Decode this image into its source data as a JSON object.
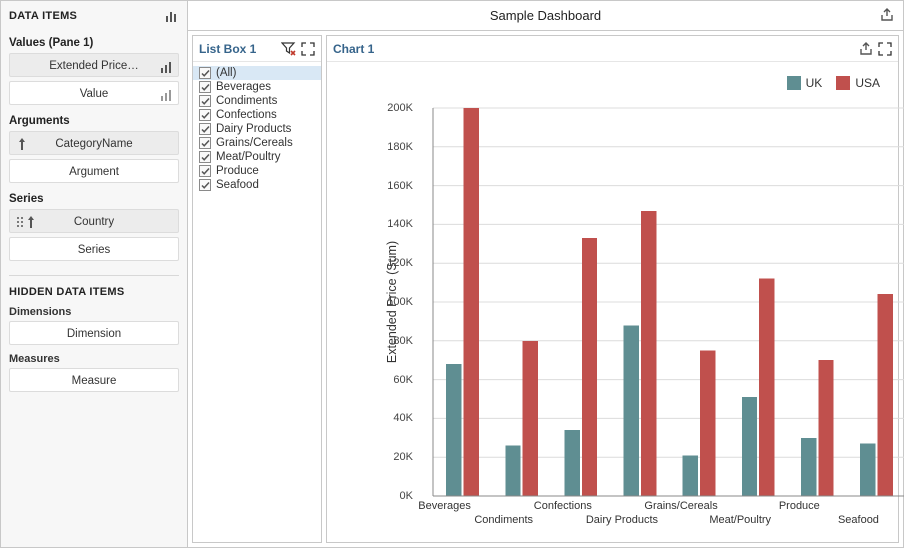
{
  "side": {
    "heading": "DATA ITEMS",
    "values_label": "Values (Pane 1)",
    "values_slot_filled": "Extended Price…",
    "values_slot_empty": "Value",
    "arguments_label": "Arguments",
    "arguments_slot_filled": "CategoryName",
    "arguments_slot_empty": "Argument",
    "series_label": "Series",
    "series_slot_filled": "Country",
    "series_slot_empty": "Series",
    "hidden_heading": "HIDDEN DATA ITEMS",
    "dimensions_label": "Dimensions",
    "dimensions_slot": "Dimension",
    "measures_label": "Measures",
    "measures_slot": "Measure"
  },
  "dashboard_title": "Sample Dashboard",
  "listbox": {
    "title": "List Box 1",
    "items": [
      "(All)",
      "Beverages",
      "Condiments",
      "Confections",
      "Dairy Products",
      "Grains/Cereals",
      "Meat/Poultry",
      "Produce",
      "Seafood"
    ],
    "selected_index": 0
  },
  "chart": {
    "title": "Chart 1",
    "legend": {
      "uk": "UK",
      "usa": "USA"
    },
    "colors": {
      "uk": "#5f8e92",
      "usa": "#c0504d"
    },
    "ylabel": "Extended Price (Sum)"
  },
  "chart_data": {
    "type": "bar",
    "title": "",
    "xlabel": "",
    "ylabel": "Extended Price (Sum)",
    "ylim": [
      0,
      200000
    ],
    "yticks": [
      0,
      20000,
      40000,
      60000,
      80000,
      100000,
      120000,
      140000,
      160000,
      180000,
      200000
    ],
    "ytick_labels": [
      "0K",
      "20K",
      "40K",
      "60K",
      "80K",
      "100K",
      "120K",
      "140K",
      "160K",
      "180K",
      "200K"
    ],
    "categories": [
      "Beverages",
      "Condiments",
      "Confections",
      "Dairy Products",
      "Grains/Cereals",
      "Meat/Poultry",
      "Produce",
      "Seafood"
    ],
    "series": [
      {
        "name": "UK",
        "color": "#5f8e92",
        "values": [
          68000,
          26000,
          34000,
          88000,
          21000,
          51000,
          30000,
          27000
        ]
      },
      {
        "name": "USA",
        "color": "#c0504d",
        "values": [
          200000,
          80000,
          133000,
          147000,
          75000,
          112000,
          70000,
          104000
        ]
      }
    ],
    "legend_position": "top-right",
    "grid": true
  }
}
